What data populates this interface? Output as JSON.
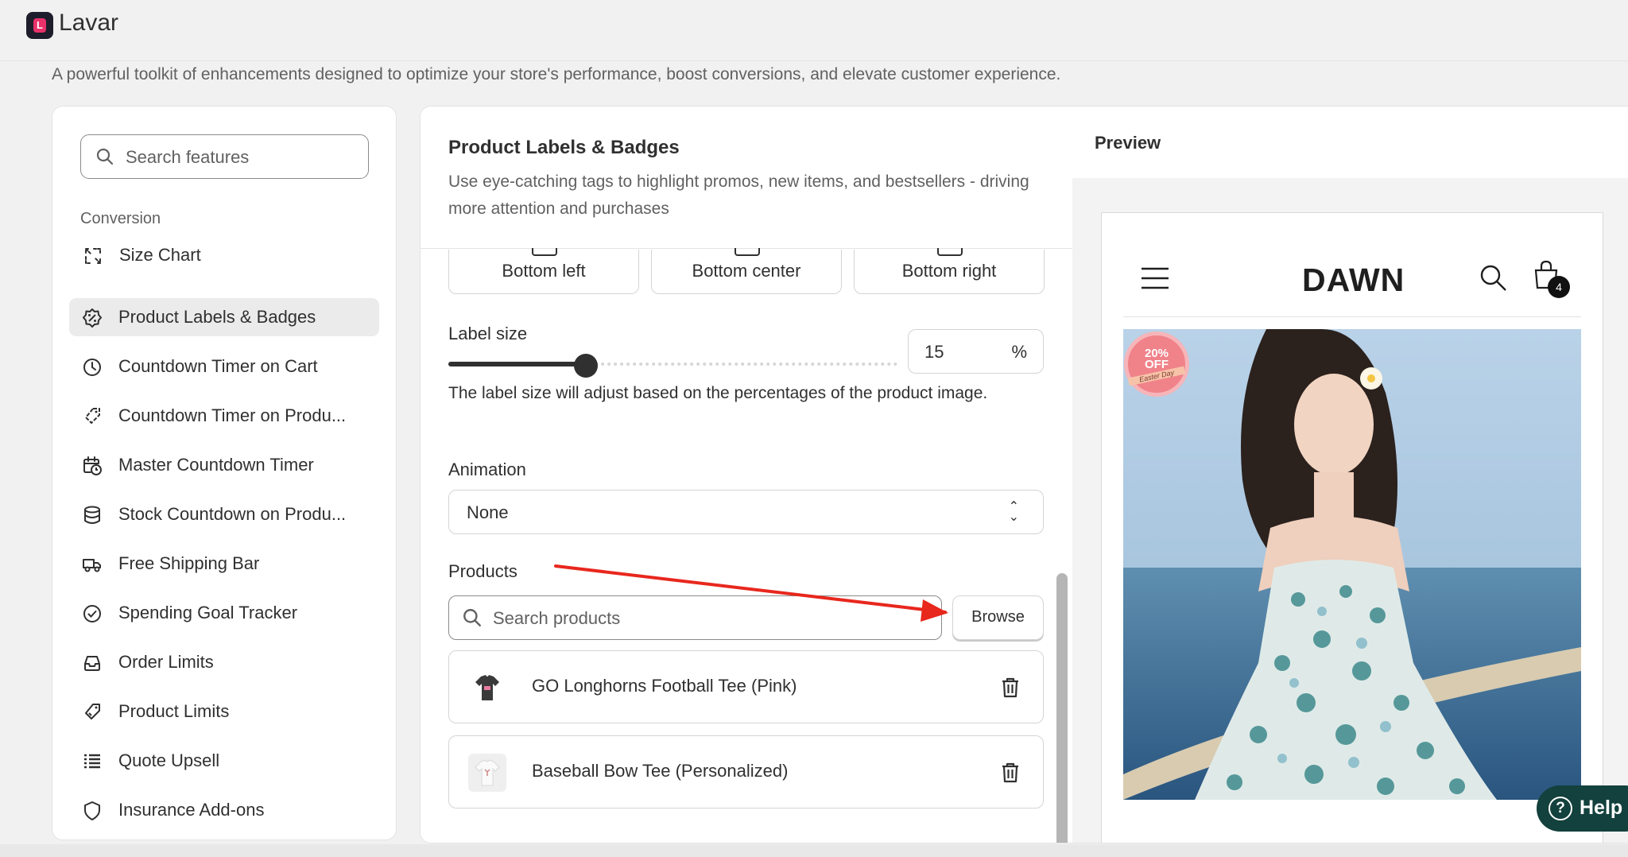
{
  "app": {
    "title": "Lavar",
    "subtitle": "A powerful toolkit of enhancements designed to optimize your store's performance, boost conversions, and elevate customer experience."
  },
  "sidebar": {
    "search_placeholder": "Search features",
    "section_label": "Conversion",
    "items": [
      {
        "label": "Size Chart",
        "icon": "size-chart-icon"
      },
      {
        "label": "Product Labels & Badges",
        "icon": "badge-icon",
        "active": true
      },
      {
        "label": "Countdown Timer on Cart",
        "icon": "clock-icon"
      },
      {
        "label": "Countdown Timer on Produ...",
        "icon": "timer-tag-icon"
      },
      {
        "label": "Master Countdown Timer",
        "icon": "calendar-clock-icon"
      },
      {
        "label": "Stock Countdown on Produ...",
        "icon": "database-icon"
      },
      {
        "label": "Free Shipping Bar",
        "icon": "truck-icon"
      },
      {
        "label": "Spending Goal Tracker",
        "icon": "check-circle-icon"
      },
      {
        "label": "Order Limits",
        "icon": "inbox-icon"
      },
      {
        "label": "Product Limits",
        "icon": "tag-limit-icon"
      },
      {
        "label": "Quote Upsell",
        "icon": "list-icon"
      },
      {
        "label": "Insurance Add-ons",
        "icon": "shield-icon"
      }
    ]
  },
  "settings": {
    "title": "Product Labels & Badges",
    "description": "Use eye-catching tags to highlight promos, new items, and bestsellers - driving more attention and purchases",
    "positions": [
      "Bottom left",
      "Bottom center",
      "Bottom right"
    ],
    "label_size": {
      "label": "Label size",
      "value": "15",
      "unit": "%",
      "fraction": 0.31,
      "help": "The label size will adjust based on the percentages of the product image."
    },
    "animation": {
      "label": "Animation",
      "value": "None"
    },
    "products": {
      "label": "Products",
      "search_placeholder": "Search products",
      "browse_label": "Browse",
      "items": [
        {
          "name": "GO Longhorns Football Tee (Pink)"
        },
        {
          "name": "Baseball Bow Tee (Personalized)"
        }
      ]
    }
  },
  "preview": {
    "title": "Preview",
    "store_name": "DAWN",
    "cart_count": "4",
    "badge": {
      "percent": "20%",
      "off": "OFF",
      "caption": "Easter Day"
    }
  },
  "help_button": {
    "label": "Help"
  },
  "colors": {
    "accent_dark": "#303030",
    "help_bg": "#13413d",
    "arrow": "#e8271d",
    "badge": "#f0828a"
  }
}
